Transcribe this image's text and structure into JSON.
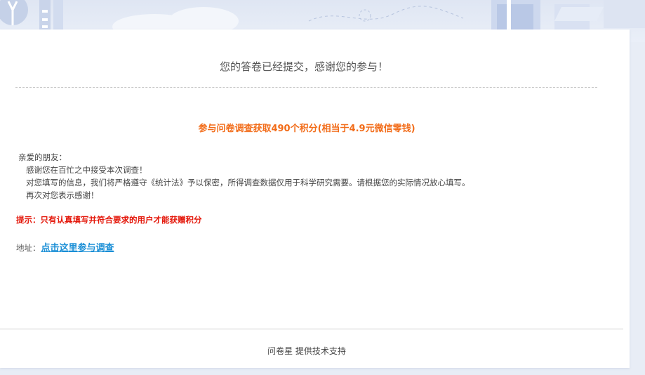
{
  "page": {
    "title": "您的答卷已经提交，感谢您的参与！",
    "promo": "参与问卷调查获取490个积分(相当于4.9元微信零钱)",
    "letter": {
      "greeting": "亲爱的朋友：",
      "line1": "感谢您在百忙之中接受本次调查！",
      "line2": "对您填写的信息，我们将严格遵守《统计法》予以保密，所得调查数据仅用于科学研究需要。请根据您的实际情况放心填写。",
      "line3": "再次对您表示感谢！"
    },
    "tip": "提示：只有认真填写并符合要求的用户才能获赠积分",
    "address_label": "地址：",
    "address_link": "点击这里参与调查",
    "footer_brand": "问卷星",
    "footer_text": "提供技术支持"
  },
  "colors": {
    "promo": "#f26c19",
    "tip": "#e4170a",
    "link": "#1b8fd6",
    "background": "#e8edf6"
  }
}
